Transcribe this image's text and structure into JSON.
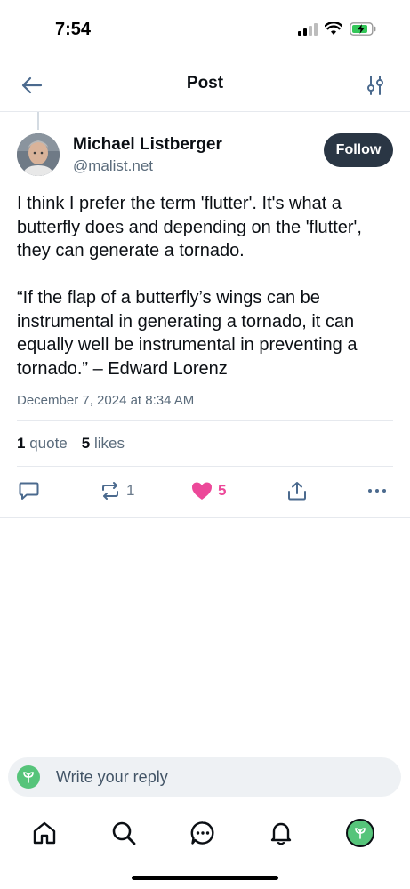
{
  "status_bar": {
    "time": "7:54"
  },
  "header": {
    "title": "Post"
  },
  "post": {
    "author_name": "Michael Listberger",
    "author_handle": "@malist.net",
    "follow_label": "Follow",
    "text": "I think I prefer the term 'flutter'.  It's what a butterfly does and depending on the 'flutter', they can generate a tornado.\n\n“If the flap of a butterfly’s wings can be instrumental in generating a tornado, it can equally well be instrumental in preventing a tornado.” – Edward Lorenz",
    "date": "December 7, 2024 at 8:34 AM",
    "stats": {
      "quotes_count": "1",
      "quotes_label": "quote",
      "likes_count": "5",
      "likes_label": "likes"
    },
    "actions": {
      "repost_count": "1",
      "like_count": "5"
    }
  },
  "reply": {
    "placeholder": "Write your reply"
  },
  "colors": {
    "accent": "#ec4899",
    "follow_bg": "#2a3644",
    "icon": "#4b6a8e",
    "avatar_green": "#56c47a"
  },
  "icons": [
    "back-arrow-icon",
    "filter-icon",
    "comment-icon",
    "repost-icon",
    "heart-icon",
    "share-icon",
    "more-icon",
    "home-icon",
    "search-icon",
    "chat-icon",
    "bell-icon"
  ]
}
